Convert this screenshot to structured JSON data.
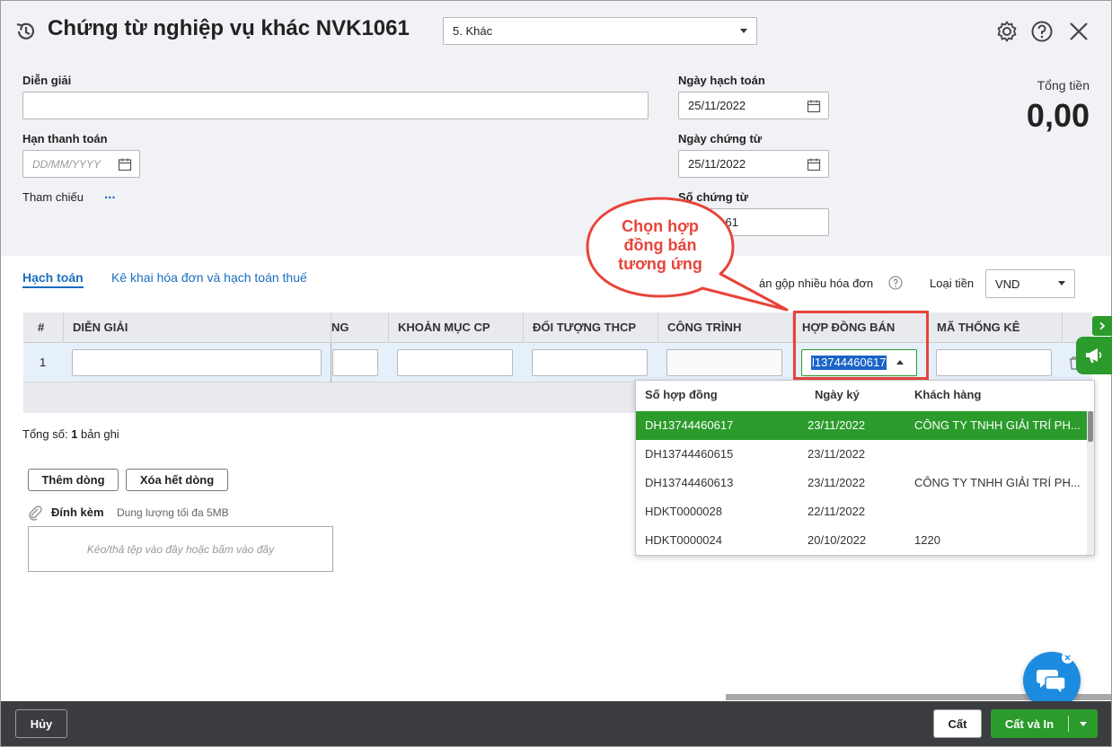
{
  "header": {
    "title": "Chứng từ nghiệp vụ khác NVK1061",
    "type_select": "5. Khác"
  },
  "form": {
    "dien_giai_label": "Diễn giải",
    "dien_giai_value": "",
    "han_thanh_toan_label": "Hạn thanh toán",
    "han_thanh_toan_placeholder": "DD/MM/YYYY",
    "tham_chieu_label": "Tham chiếu",
    "tham_chieu_link": "...",
    "ngay_hach_toan_label": "Ngày hạch toán",
    "ngay_hach_toan_value": "25/11/2022",
    "ngay_chung_tu_label": "Ngày chứng từ",
    "ngay_chung_tu_value": "25/11/2022",
    "so_chung_tu_label": "Số chứng từ",
    "so_chung_tu_value": "61",
    "tong_tien_label": "Tổng tiền",
    "tong_tien_value": "0,00"
  },
  "tabs": {
    "hach_toan": "Hạch toán",
    "ke_khai": "Kê khai hóa đơn và hạch toán thuế"
  },
  "options": {
    "gop_hoa_don_label": "án gộp nhiều hóa đơn",
    "loai_tien_label": "Loại tiền",
    "loai_tien_value": "VND"
  },
  "grid": {
    "columns": {
      "stt": "#",
      "dien_giai": "DIỄN GIẢI",
      "ng": "NG",
      "khoan_muc_cp": "KHOẢN MỤC CP",
      "doi_tuong_thcp": "ĐỐI TƯỢNG THCP",
      "cong_trinh": "CÔNG TRÌNH",
      "hop_dong_ban": "HỢP ĐỒNG BÁN",
      "ma_thong_ke": "MÃ THỐNG KÊ"
    },
    "row_number": "1",
    "hop_dong_value": "l13744460617"
  },
  "summary": {
    "prefix": "Tổng số: ",
    "count": "1",
    "suffix": " bản ghi"
  },
  "buttons": {
    "them_dong": "Thêm dòng",
    "xoa_het_dong": "Xóa hết dòng",
    "huy": "Hủy",
    "cat": "Cất",
    "cat_va_in": "Cất và In"
  },
  "attachment": {
    "label": "Đính kèm",
    "hint": "Dung lượng tối đa 5MB",
    "dropzone": "Kéo/thả tệp vào đây hoặc bấm vào đây"
  },
  "dropdown": {
    "headers": [
      "Số hợp đồng",
      "Ngày ký",
      "Khách hàng"
    ],
    "rows": [
      {
        "so": "DH13744460617",
        "ngay": "23/11/2022",
        "khach": "CÔNG TY TNHH GIẢI TRÍ PH..."
      },
      {
        "so": "DH13744460615",
        "ngay": "23/11/2022",
        "khach": ""
      },
      {
        "so": "DH13744460613",
        "ngay": "23/11/2022",
        "khach": "CÔNG TY TNHH GIẢI TRÍ PH..."
      },
      {
        "so": "HDKT0000028",
        "ngay": "22/11/2022",
        "khach": ""
      },
      {
        "so": "HDKT0000024",
        "ngay": "20/10/2022",
        "khach": "1220"
      }
    ],
    "selected_index": 0
  },
  "callout": {
    "line1": "Chọn hợp",
    "line2": "đồng bán",
    "line3": "tương ứng"
  },
  "colors": {
    "accent_green": "#2b9b2b",
    "link_blue": "#1a6dbf",
    "callout_red": "#e8443a",
    "bottom_bar": "#3b3d41",
    "chat_blue": "#1d8ce0"
  }
}
